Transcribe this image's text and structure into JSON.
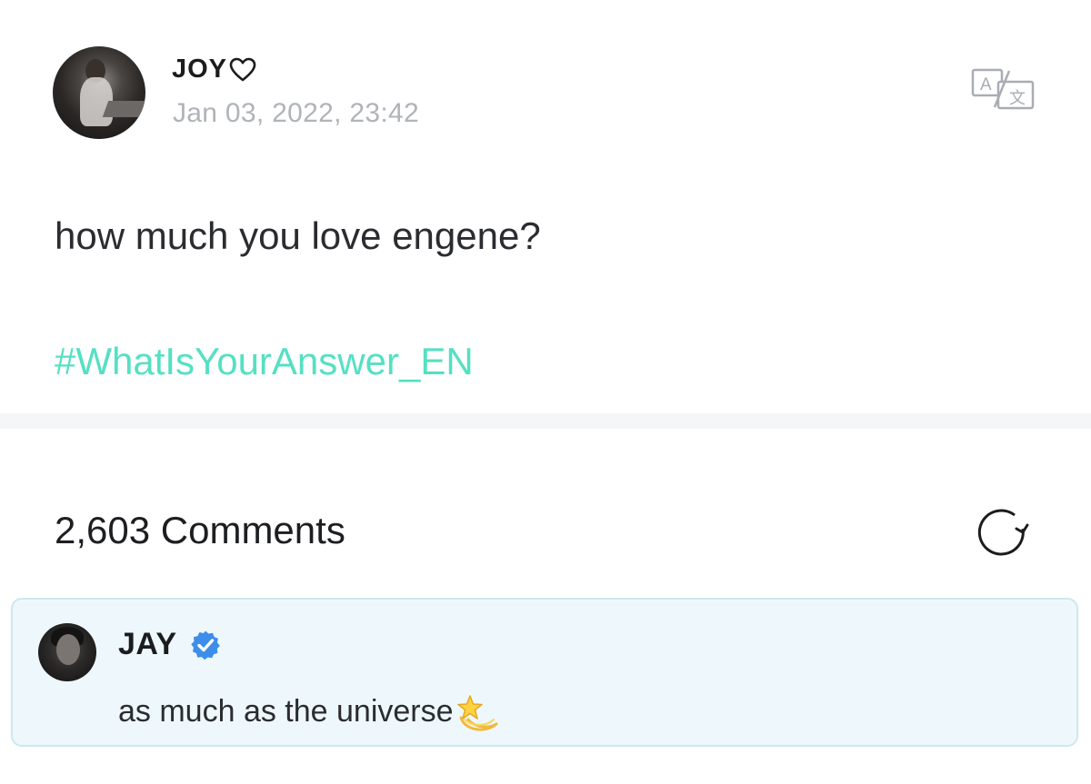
{
  "post": {
    "author": "JOY",
    "author_icon": "heart-outline-icon",
    "date": "Jan 03, 2022, 23:42",
    "text": "how much you love engene?",
    "hashtag": "#WhatIsYourAnswer_EN",
    "hashtag_color": "#55e0c3",
    "translate_icon": "translate-icon"
  },
  "comments": {
    "count_label": "2,603 Comments",
    "refresh_icon": "refresh-icon",
    "items": [
      {
        "author": "JAY",
        "verified": true,
        "verified_icon": "verified-badge-icon",
        "text": "as much as the universe",
        "emoji_icon": "dizzy-star-icon",
        "background": "#eef8fc"
      }
    ]
  }
}
